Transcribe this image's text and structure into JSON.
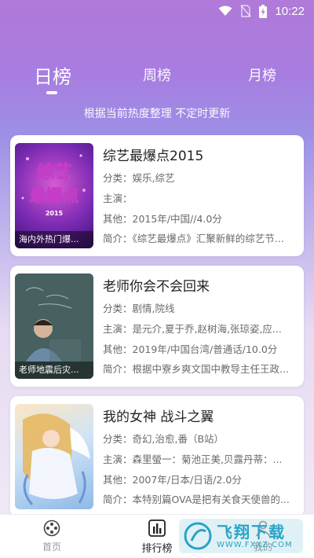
{
  "status_bar": {
    "time": "10:22"
  },
  "tabs": [
    {
      "label": "日榜",
      "active": true
    },
    {
      "label": "周榜",
      "active": false
    },
    {
      "label": "月榜",
      "active": false
    }
  ],
  "subtitle": "根据当前热度整理 不定时更新",
  "items": [
    {
      "title": "综艺最爆点2015",
      "poster_caption": "海内外热门爆...",
      "poster_art": {
        "line1": "综艺",
        "line2": "最爆点",
        "year": "2015"
      },
      "category_label": "分类：",
      "category": "娱乐,综艺",
      "cast_label": "主演：",
      "cast": "",
      "other_label": "其他：",
      "other": "2015年/中国//4.0分",
      "summary_label": "简介：",
      "summary": "《综艺最爆点》汇聚新鲜的综艺节..."
    },
    {
      "title": "老师你会不会回来",
      "poster_caption": "老师地震后灾...",
      "category_label": "分类：",
      "category": "剧情,院线",
      "cast_label": "主演：",
      "cast": "是元介,夏于乔,赵树海,张琼姿,应...",
      "other_label": "其他：",
      "other": "2019年/中国台湾/普通话/10.0分",
      "summary_label": "简介：",
      "summary": "根据中寮乡爽文国中教导主任王政..."
    },
    {
      "title": "我的女神 战斗之翼",
      "poster_caption": "",
      "category_label": "分类：",
      "category": "奇幻,治愈,番（B站）",
      "cast_label": "主演：",
      "cast": "森里螢一：菊池正美,贝露丹蒂：...",
      "other_label": "其他：",
      "other": "2007年/日本/日语/2.0分",
      "summary_label": "简介：",
      "summary": "本特别篇OVA是把有关食天使兽的..."
    }
  ],
  "bottom_nav": [
    {
      "label": "首页",
      "icon": "film-reel-icon",
      "active": false
    },
    {
      "label": "排行榜",
      "icon": "bar-chart-icon",
      "active": true
    },
    {
      "label": "我的",
      "icon": "user-icon",
      "active": false
    }
  ],
  "watermark": {
    "text": "飞翔下载",
    "sub": "WWW.FXXZ.COM"
  }
}
